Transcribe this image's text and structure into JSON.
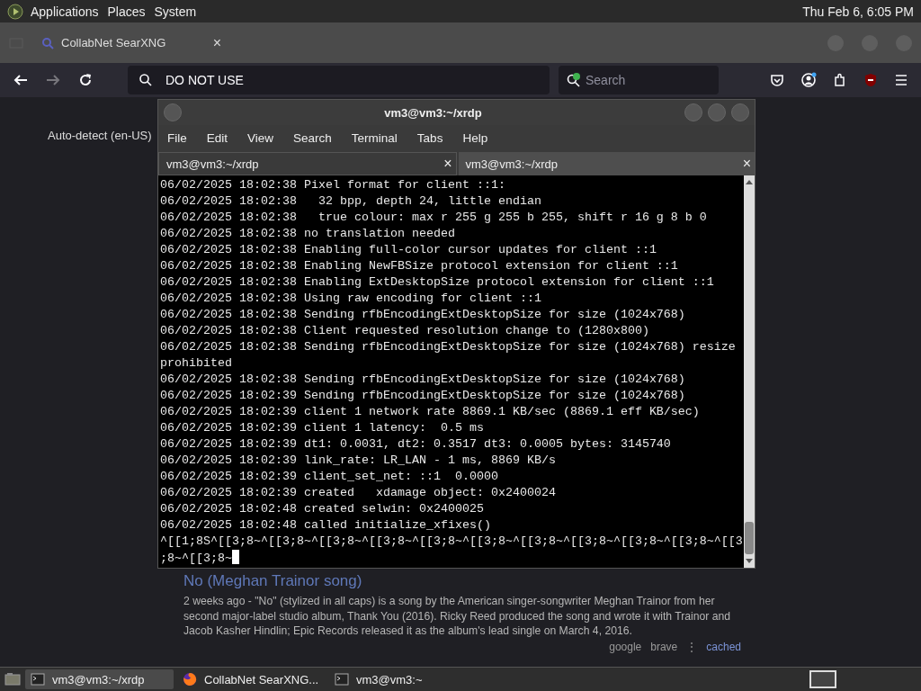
{
  "top_panel": {
    "menus": [
      "Applications",
      "Places",
      "System"
    ],
    "clock": "Thu Feb  6, 6:05 PM"
  },
  "browser": {
    "tab": {
      "title": "CollabNet SearXNG",
      "close": "×"
    },
    "address": "DO NOT USE",
    "search_placeholder": "Search",
    "language": "Auto-detect (en-US)",
    "result": {
      "title": "No (Meghan Trainor song)",
      "snippet": "2 weeks ago - \"No\" (stylized in all caps) is a song by the American singer-songwriter Meghan Trainor from her second major-label studio album, Thank You (2016). Ricky Reed produced the song and wrote it with Trainor and Jacob Kasher Hindlin; Epic Records released it as the album's lead single on March 4, 2016.",
      "engines": [
        "google",
        "brave"
      ],
      "separator": "⋮",
      "cached": "cached"
    }
  },
  "terminal": {
    "title": "vm3@vm3:~/xrdp",
    "menus": [
      "File",
      "Edit",
      "View",
      "Search",
      "Terminal",
      "Tabs",
      "Help"
    ],
    "tabs": [
      {
        "label": "vm3@vm3:~/xrdp",
        "close": "×",
        "selected": true
      },
      {
        "label": "vm3@vm3:~/xrdp",
        "close": "×",
        "selected": false
      }
    ],
    "lines": [
      "06/02/2025 18:02:38 Pixel format for client ::1:",
      "06/02/2025 18:02:38   32 bpp, depth 24, little endian",
      "06/02/2025 18:02:38   true colour: max r 255 g 255 b 255, shift r 16 g 8 b 0",
      "06/02/2025 18:02:38 no translation needed",
      "06/02/2025 18:02:38 Enabling full-color cursor updates for client ::1",
      "06/02/2025 18:02:38 Enabling NewFBSize protocol extension for client ::1",
      "06/02/2025 18:02:38 Enabling ExtDesktopSize protocol extension for client ::1",
      "06/02/2025 18:02:38 Using raw encoding for client ::1",
      "06/02/2025 18:02:38 Sending rfbEncodingExtDesktopSize for size (1024x768)",
      "06/02/2025 18:02:38 Client requested resolution change to (1280x800)",
      "06/02/2025 18:02:38 Sending rfbEncodingExtDesktopSize for size (1024x768) resize",
      "prohibited",
      "06/02/2025 18:02:38 Sending rfbEncodingExtDesktopSize for size (1024x768)",
      "06/02/2025 18:02:39 Sending rfbEncodingExtDesktopSize for size (1024x768)",
      "06/02/2025 18:02:39 client 1 network rate 8869.1 KB/sec (8869.1 eff KB/sec)",
      "06/02/2025 18:02:39 client 1 latency:  0.5 ms",
      "06/02/2025 18:02:39 dt1: 0.0031, dt2: 0.3517 dt3: 0.0005 bytes: 3145740",
      "06/02/2025 18:02:39 link_rate: LR_LAN - 1 ms, 8869 KB/s",
      "06/02/2025 18:02:39 client_set_net: ::1  0.0000",
      "06/02/2025 18:02:39 created   xdamage object: 0x2400024",
      "06/02/2025 18:02:48 created selwin: 0x2400025",
      "06/02/2025 18:02:48 called initialize_xfixes()",
      "^[[1;8S^[[3;8~^[[3;8~^[[3;8~^[[3;8~^[[3;8~^[[3;8~^[[3;8~^[[3;8~^[[3;8~^[[3;8~^[[3",
      ";8~^[[3;8~"
    ]
  },
  "taskbar": [
    {
      "label": "vm3@vm3:~/xrdp",
      "kind": "terminal",
      "selected": true
    },
    {
      "label": "CollabNet SearXNG...",
      "kind": "browser",
      "selected": false
    },
    {
      "label": "vm3@vm3:~",
      "kind": "terminal",
      "selected": false
    }
  ]
}
